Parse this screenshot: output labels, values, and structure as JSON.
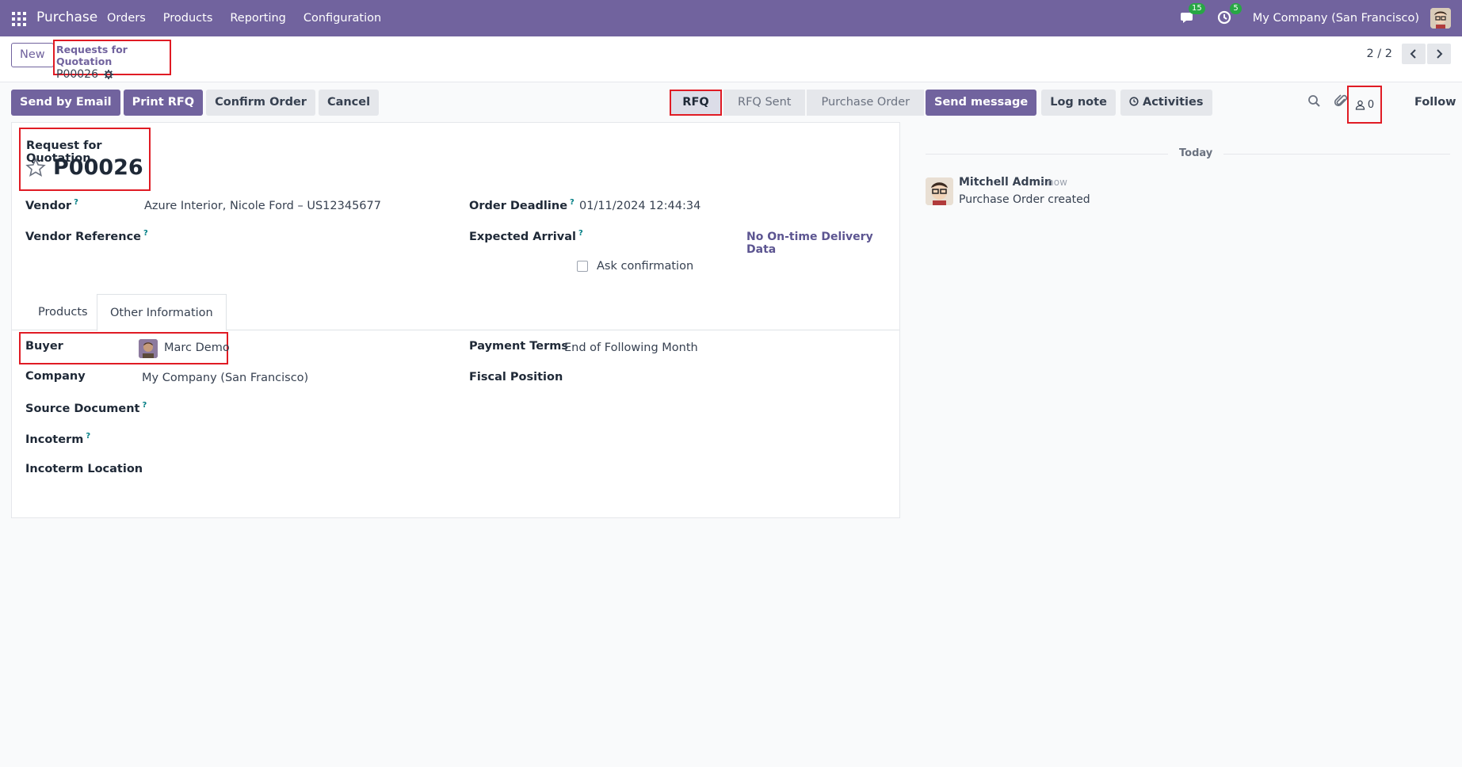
{
  "navbar": {
    "app_name": "Purchase",
    "menu": [
      "Orders",
      "Products",
      "Reporting",
      "Configuration"
    ],
    "messages_count": "15",
    "activities_count": "5",
    "company": "My Company (San Francisco)"
  },
  "control": {
    "new_label": "New",
    "breadcrumb_parent": "Requests for Quotation",
    "breadcrumb_current": "P00026",
    "pager_value": "2 / 2"
  },
  "actions": {
    "send_email": "Send by Email",
    "print_rfq": "Print RFQ",
    "confirm_order": "Confirm Order",
    "cancel": "Cancel"
  },
  "status": {
    "stages": [
      "RFQ",
      "RFQ Sent",
      "Purchase Order"
    ],
    "active": "RFQ"
  },
  "form": {
    "title_sub": "Request for Quotation",
    "title_num": "P00026",
    "vendor_label": "Vendor",
    "vendor_value": "Azure Interior, Nicole Ford – US12345677",
    "vendor_ref_label": "Vendor Reference",
    "order_deadline_label": "Order Deadline",
    "order_deadline_value": "01/11/2024 12:44:34",
    "expected_arrival_label": "Expected Arrival",
    "ontime_text": "No On-time Delivery Data",
    "ask_confirmation": "Ask confirmation",
    "tabs": [
      "Products",
      "Other Information"
    ],
    "active_tab": "Other Information",
    "buyer_label": "Buyer",
    "buyer_value": "Marc Demo",
    "company_label": "Company",
    "company_value": "My Company (San Francisco)",
    "source_doc_label": "Source Document",
    "incoterm_label": "Incoterm",
    "incoterm_location_label": "Incoterm Location",
    "payment_terms_label": "Payment Terms",
    "payment_terms_value": "End of Following Month",
    "fiscal_position_label": "Fiscal Position"
  },
  "chatter": {
    "send_message": "Send message",
    "log_note": "Log note",
    "activities": "Activities",
    "followers_count": "0",
    "follow": "Follow",
    "today": "Today",
    "message": {
      "author": "Mitchell Admin",
      "time": "- now",
      "body": "Purchase Order created"
    }
  },
  "colors": {
    "brand": "#71639e",
    "highlight": "#e01b24",
    "badge": "#28a745"
  }
}
